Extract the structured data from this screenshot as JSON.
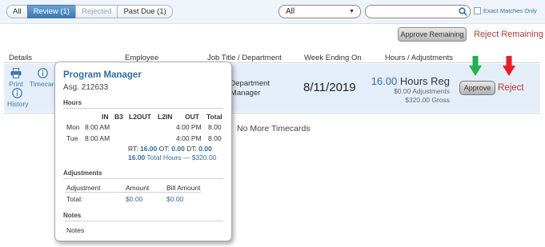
{
  "filters": {
    "tabs": [
      {
        "label": "All"
      },
      {
        "label": "Review (1)"
      },
      {
        "label": "Rejected"
      },
      {
        "label": "Past Due (1)"
      }
    ],
    "select_value": "All",
    "search_placeholder": "",
    "exact_matches_label": "Exact Matches Only"
  },
  "actions": {
    "approve_remaining": "Approve Remaining",
    "reject_remaining": "Reject Remaining"
  },
  "columns": {
    "details": "Details",
    "employee": "Employee",
    "job_title": "Job Title / Department",
    "week_ending": "Week Ending On",
    "hours": "Hours / Adjustments"
  },
  "row": {
    "print_label": "Print",
    "timecard_label": "Timecard",
    "history_label": "History",
    "job_line1": "s Department",
    "job_line2": "n Manager",
    "week_ending": "8/11/2019",
    "hours_value": "16.00",
    "hours_type": "Hours Reg",
    "adjustments": "$0.00 Adjustments",
    "gross": "$320.00 Gross",
    "approve_label": "Approve",
    "reject_label": "Reject"
  },
  "no_more": "No More Timecards",
  "popup": {
    "title": "Program Manager",
    "assignment": "Asg. 212633",
    "hours_section": "Hours",
    "hours_headers": [
      "IN",
      "B3",
      "L2OUT",
      "L2IN",
      "OUT",
      "Total"
    ],
    "days": [
      {
        "day": "Mon",
        "in": "8:00 AM",
        "out": "4:00 PM",
        "total": "8.00"
      },
      {
        "day": "Tue",
        "in": "8:00 AM",
        "out": "4:00 PM",
        "total": "8.00"
      }
    ],
    "rt_label": "RT:",
    "rt_value": "16.00",
    "ot_label": "OT:",
    "ot_value": "0.00",
    "dt_label": "DT:",
    "dt_value": "0.00",
    "total_value": "16.00",
    "total_text": "Total Hours — $320.00",
    "adjustments_section": "Adjustments",
    "adj_headers": [
      "Adjustment",
      "Amount",
      "Bill Amount"
    ],
    "adj_total_label": "Total:",
    "adj_amount": "$0.00",
    "adj_bill_amount": "$0.00",
    "notes_section": "Notes",
    "notes_text": "Notes"
  },
  "colors": {
    "accent_blue": "#2d6ca9",
    "reject_red": "#b93a2e",
    "arrow_green": "#22b14c",
    "arrow_red": "#ed1c24",
    "row_highlight": "#e4eef8"
  }
}
